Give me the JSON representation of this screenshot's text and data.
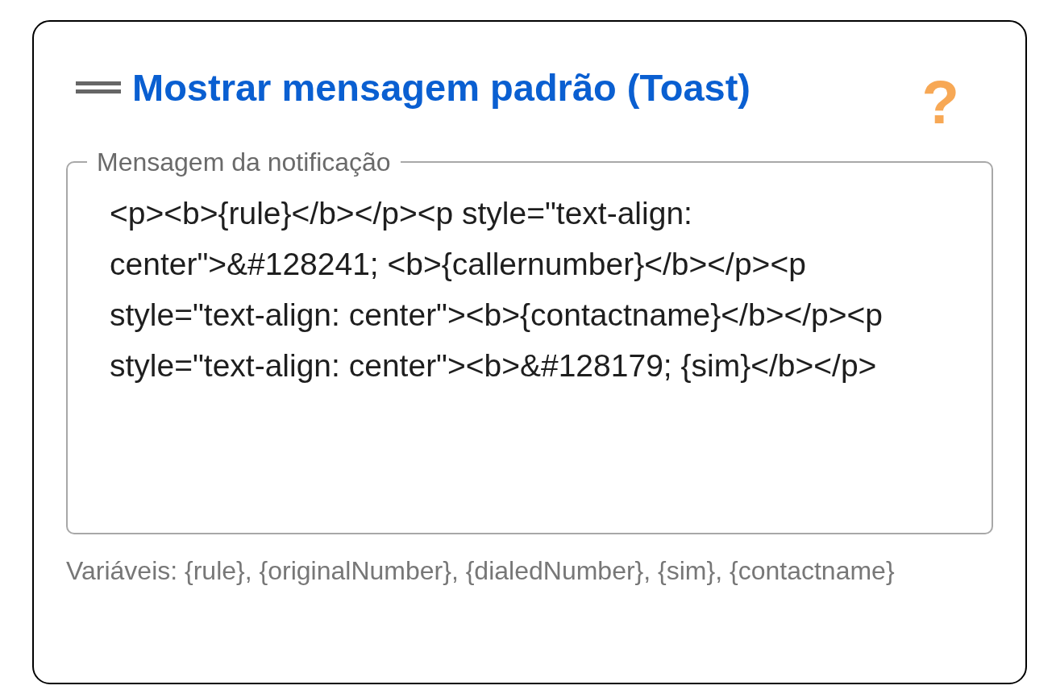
{
  "card": {
    "title": "Mostrar mensagem padrão (Toast)",
    "help_glyph": "?",
    "message_field": {
      "label": "Mensagem da notificação",
      "value": "<p><b>{rule}</b></p><p style=\"text-align: center\">&#128241; <b>{callernumber}</b></p><p style=\"text-align: center\"><b>{contactname}</b></p><p style=\"text-align: center\"><b>&#128179; {sim}</b></p>"
    },
    "helper_text": "Variáveis: {rule}, {originalNumber}, {dialedNumber}, {sim}, {contactname}"
  }
}
